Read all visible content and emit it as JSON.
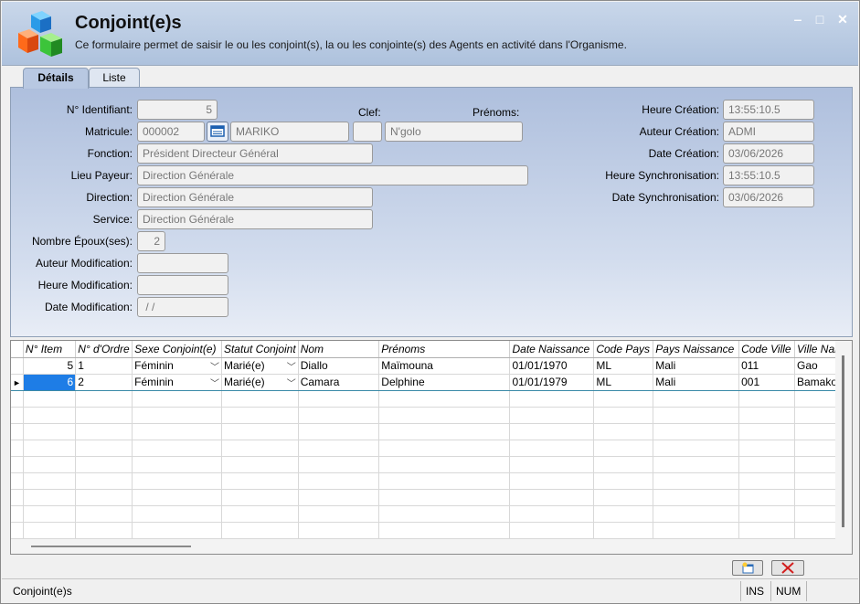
{
  "window": {
    "title": "Conjoint(e)s",
    "subtitle": "Ce formulaire permet de saisir le ou les conjoint(s), la ou les conjointe(s) des Agents en activité dans l'Organisme."
  },
  "tabs": [
    {
      "label": "Détails"
    },
    {
      "label": "Liste"
    }
  ],
  "form": {
    "identifiant_label": "N° Identifiant:",
    "identifiant": "5",
    "clef_label": "Clef:",
    "prenoms_label": "Prénoms:",
    "matricule_label": "Matricule:",
    "matricule": "000002",
    "nom": "MARIKO",
    "clef": "",
    "prenoms": "N'golo",
    "fonction_label": "Fonction:",
    "fonction": "Président Directeur Général",
    "lieu_payeur_label": "Lieu Payeur:",
    "lieu_payeur": "Direction Générale",
    "direction_label": "Direction:",
    "direction": "Direction Générale",
    "service_label": "Service:",
    "service": "Direction Générale",
    "nombre_epoux_label": "Nombre Époux(ses):",
    "nombre_epoux": "2",
    "auteur_modif_label": "Auteur Modification:",
    "auteur_modif": "",
    "heure_modif_label": "Heure Modification:",
    "heure_modif": "",
    "date_modif_label": "Date Modification:",
    "date_modif": " / /",
    "heure_creation_label": "Heure Création:",
    "heure_creation": "13:55:10.5",
    "auteur_creation_label": "Auteur Création:",
    "auteur_creation": "ADMI",
    "date_creation_label": "Date Création:",
    "date_creation": "03/06/2026",
    "heure_sync_label": "Heure Synchronisation:",
    "heure_sync": "13:55:10.5",
    "date_sync_label": "Date Synchronisation:",
    "date_sync": "03/06/2026"
  },
  "grid": {
    "columns": [
      "N° Item",
      "N° d'Ordre",
      "Sexe Conjoint(e)",
      "Statut Conjoint",
      "Nom",
      "Prénoms",
      "Date Naissance",
      "Code Pays",
      "Pays Naissance",
      "Code Ville",
      "Ville Naiss"
    ],
    "rows": [
      {
        "item": "5",
        "ordre": "1",
        "sexe": "Féminin",
        "statut": "Marié(e)",
        "nom": "Diallo",
        "prenoms": "Maïmouna",
        "date": "01/01/1970",
        "code_pays": "ML",
        "pays": "Mali",
        "code_ville": "011",
        "ville": "Gao"
      },
      {
        "item": "6",
        "ordre": "2",
        "sexe": "Féminin",
        "statut": "Marié(e)",
        "nom": "Camara",
        "prenoms": "Delphine",
        "date": "01/01/1979",
        "code_pays": "ML",
        "pays": "Mali",
        "code_ville": "001",
        "ville": "Bamako"
      }
    ]
  },
  "status": {
    "text": "Conjoint(e)s",
    "ins": "INS",
    "num": "NUM"
  },
  "icons": {
    "logo": "cubes-logo-icon",
    "new": "new-record-icon",
    "delete": "delete-x-icon"
  }
}
